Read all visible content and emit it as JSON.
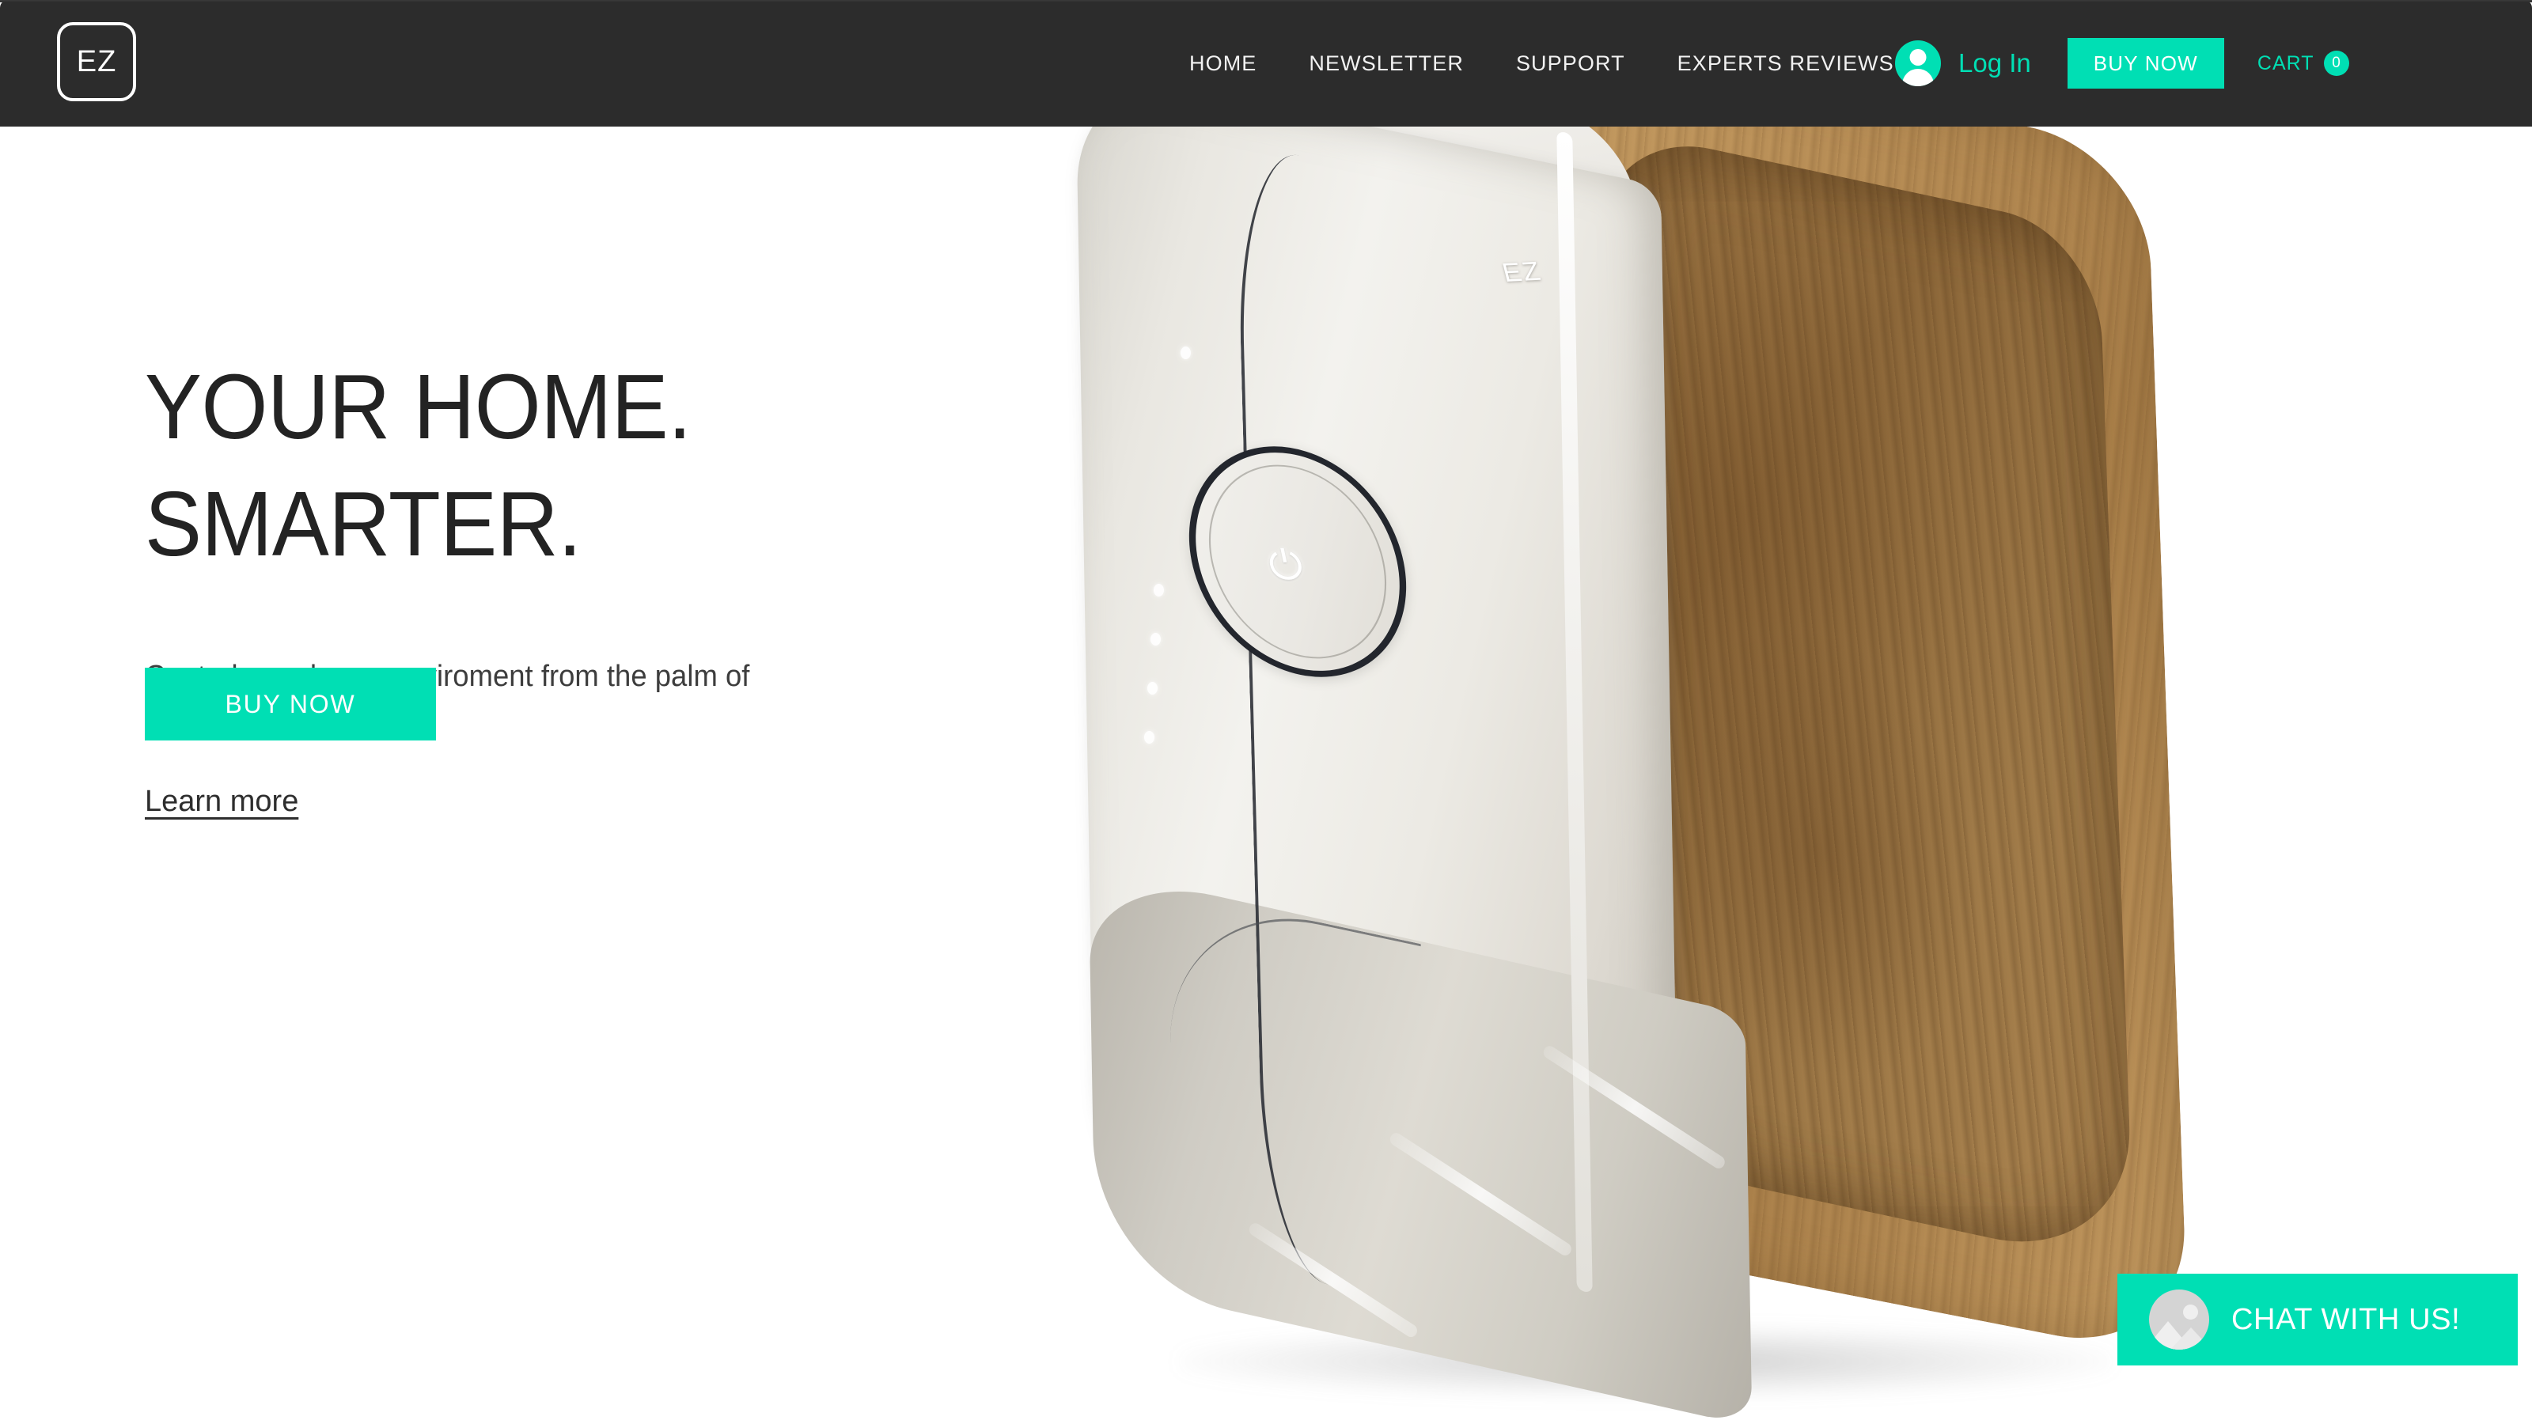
{
  "header": {
    "logo_text": "EZ",
    "nav": [
      {
        "label": "HOME"
      },
      {
        "label": "NEWSLETTER"
      },
      {
        "label": "SUPPORT"
      },
      {
        "label": "EXPERTS REVIEWS"
      }
    ],
    "login_label": "Log In",
    "buy_now_label": "BUY NOW",
    "cart_label": "CART",
    "cart_count": "0",
    "background_color": "#2c2c2c"
  },
  "hero": {
    "title_line1": "YOUR HOME.",
    "title_line2": "SMARTER.",
    "subtitle": "Control your home enviroment from the palm of your hand with EZ",
    "learn_more_label": "Learn more",
    "buy_now_label": "BUY NOW"
  },
  "product": {
    "brand_engraving": "EZ",
    "power_glyph": "⏻"
  },
  "chat": {
    "label": "CHAT WITH US!"
  },
  "theme": {
    "accent": "#00dfb4",
    "header_bg": "#2c2c2c",
    "page_bg": "#ffffff",
    "text_dark": "#232323",
    "wood_light": "#c79e64",
    "wood_dark": "#8c6739",
    "shell_light": "#f3f2ee",
    "shell_shadow": "#b5b1a8"
  }
}
